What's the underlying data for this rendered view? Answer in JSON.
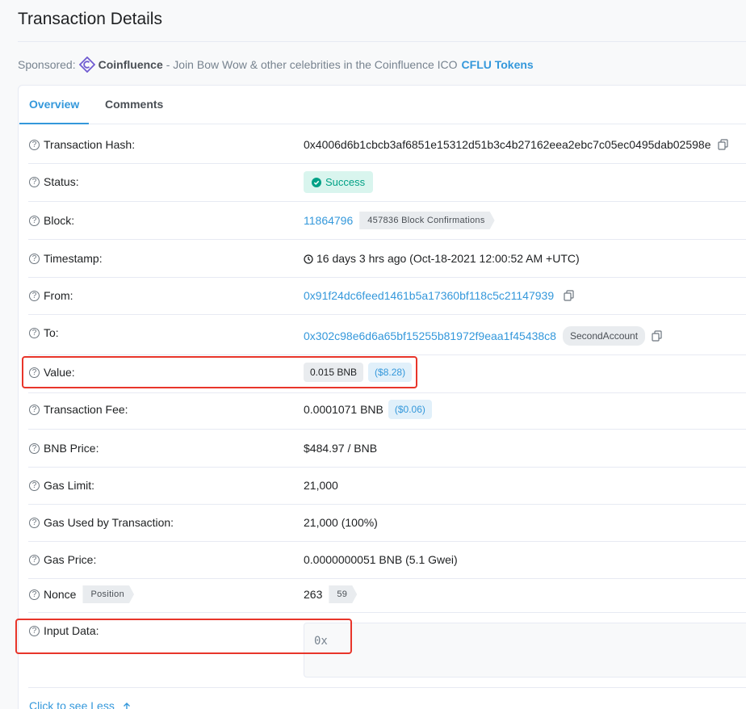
{
  "page": {
    "title": "Transaction Details"
  },
  "sponsor": {
    "prefix": "Sponsored:",
    "brand": "Coinfluence",
    "text": "- Join Bow Wow & other celebrities in the Coinfluence ICO",
    "link": "CFLU Tokens"
  },
  "tabs": [
    {
      "label": "Overview",
      "active": true
    },
    {
      "label": "Comments",
      "active": false
    }
  ],
  "rows": {
    "hash": {
      "label": "Transaction Hash:",
      "value": "0x4006d6b1cbcb3af6851e15312d51b3c4b27162eea2ebc7c05ec0495dab02598e"
    },
    "status": {
      "label": "Status:",
      "value": "Success"
    },
    "block": {
      "label": "Block:",
      "value": "11864796",
      "confirmations": "457836 Block Confirmations"
    },
    "timestamp": {
      "label": "Timestamp:",
      "value": "16 days 3 hrs ago (Oct-18-2021 12:00:52 AM +UTC)"
    },
    "from": {
      "label": "From:",
      "value": "0x91f24dc6feed1461b5a17360bf118c5c21147939"
    },
    "to": {
      "label": "To:",
      "value": "0x302c98e6d6a65bf15255b81972f9eaa1f45438c8",
      "tag": "SecondAccount"
    },
    "value": {
      "label": "Value:",
      "amount": "0.015 BNB",
      "usd": "($8.28)"
    },
    "fee": {
      "label": "Transaction Fee:",
      "amount": "0.0001071 BNB",
      "usd": "($0.06)"
    },
    "price": {
      "label": "BNB Price:",
      "value": "$484.97 / BNB"
    },
    "gas_limit": {
      "label": "Gas Limit:",
      "value": "21,000"
    },
    "gas_used": {
      "label": "Gas Used by Transaction:",
      "value": "21,000 (100%)"
    },
    "gas_price": {
      "label": "Gas Price:",
      "value": "0.0000000051 BNB (5.1 Gwei)"
    },
    "nonce": {
      "label": "Nonce",
      "position_label": "Position",
      "value": "263",
      "position": "59"
    },
    "input": {
      "label": "Input Data:",
      "value": "0x"
    }
  },
  "footer": {
    "see_less": "Click to see Less"
  },
  "colors": {
    "link": "#3498db",
    "success": "#00a186",
    "highlight": "#e8352a"
  }
}
